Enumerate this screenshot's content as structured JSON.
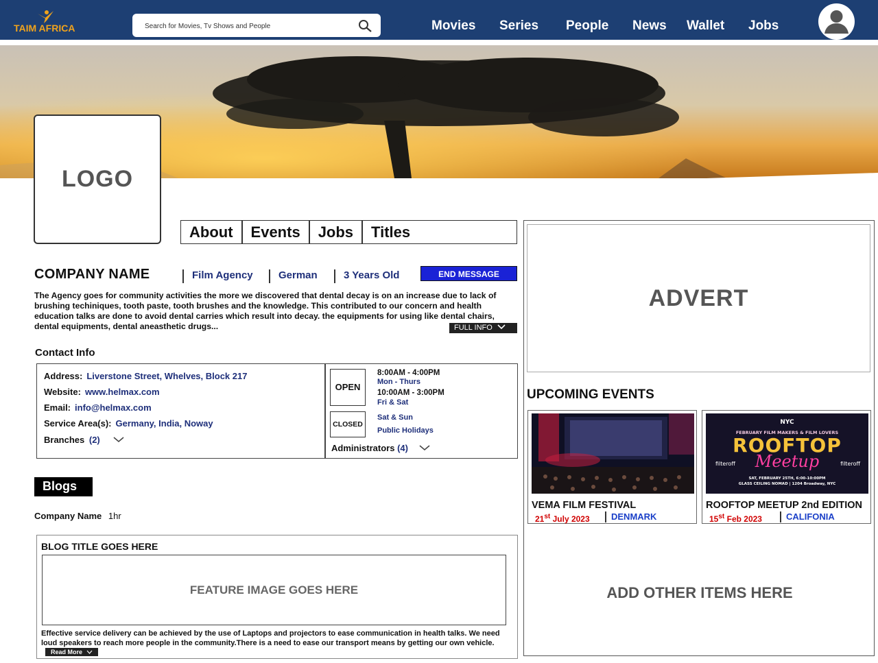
{
  "header": {
    "logo_text": "TAIM AFRICA",
    "search_placeholder": "Search for Movies, Tv Shows and People",
    "nav": [
      "Movies",
      "Series",
      "People",
      "News",
      "Wallet",
      "Jobs"
    ]
  },
  "profile": {
    "logo_label": "LOGO",
    "tabs": [
      "About",
      "Events",
      "Jobs",
      "Titles"
    ],
    "company_name": "COMPANY NAME",
    "meta": [
      "Film Agency",
      "German",
      "3 Years Old"
    ],
    "send_message": "END MESSAGE",
    "description": "The Agency goes for community activities the more we discovered that dental decay is on an increase due to lack of brushing techiniques, tooth paste, tooth brushes and the knowledge. This contributed to our concern and health education talks are done to avoid dental carries which result into decay.  the equipments for using like dental chairs, dental equipments, dental aneasthetic drugs...",
    "full_info": "FULL INFO"
  },
  "contact": {
    "heading": "Contact Info",
    "address_label": "Address:",
    "address": "Liverstone Street,  Whelves,  Block  217",
    "website_label": "Website:",
    "website": "www.helmax.com",
    "email_label": "Email:",
    "email": "info@helmax.com",
    "service_label": "Service Area(s):",
    "service": "Germany,  India,  Noway",
    "branches_label": "Branches",
    "branches_count": "(2)",
    "open_label": "OPEN",
    "closed_label": "CLOSED",
    "hours1": "8:00AM  -  4:00PM",
    "days1": "Mon  - Thurs",
    "hours2": "10:00AM  -  3:00PM",
    "days2": "Fri  & Sat",
    "closed_days1": "Sat  & Sun",
    "closed_days2": "Public Holidays",
    "admins_label": "Administrators",
    "admins_count": "(4)"
  },
  "blogs": {
    "heading": "Blogs",
    "author": "Company Name",
    "time": "1hr",
    "title": "BLOG TITLE GOES HERE",
    "feature": "FEATURE IMAGE GOES HERE",
    "text": "Effective service delivery can be achieved by the use of Laptops and projectors to ease communication in health talks. We need loud speakers to reach more people in the community.There is a need to ease our transport means by getting our own vehicle.",
    "read_more": "Read More"
  },
  "sidebar": {
    "advert": "ADVERT",
    "upcoming": "UPCOMING EVENTS",
    "events": [
      {
        "title": "VEMA FILM FESTIVAL",
        "day": "21",
        "sup": "st",
        "month_year": "July 2023",
        "location": "DENMARK"
      },
      {
        "title": "ROOFTOP MEETUP 2nd EDITION",
        "day": "15",
        "sup": "st",
        "month_year": "Feb 2023",
        "location": "CALIFONIA"
      }
    ],
    "poster": {
      "org": "NYC",
      "sub": "FEBRUARY FILM MAKERS & FILM LOVERS",
      "big1": "ROOFTOP",
      "big2": "Meetup",
      "brand": "filteroff",
      "details": "SAT, FEBRUARY 25TH, 6:00-10:00PM",
      "venue": "GLASS CEILING NOMAD | 1204 Broadway, NYC"
    },
    "add_more": "ADD OTHER ITEMS HERE"
  }
}
